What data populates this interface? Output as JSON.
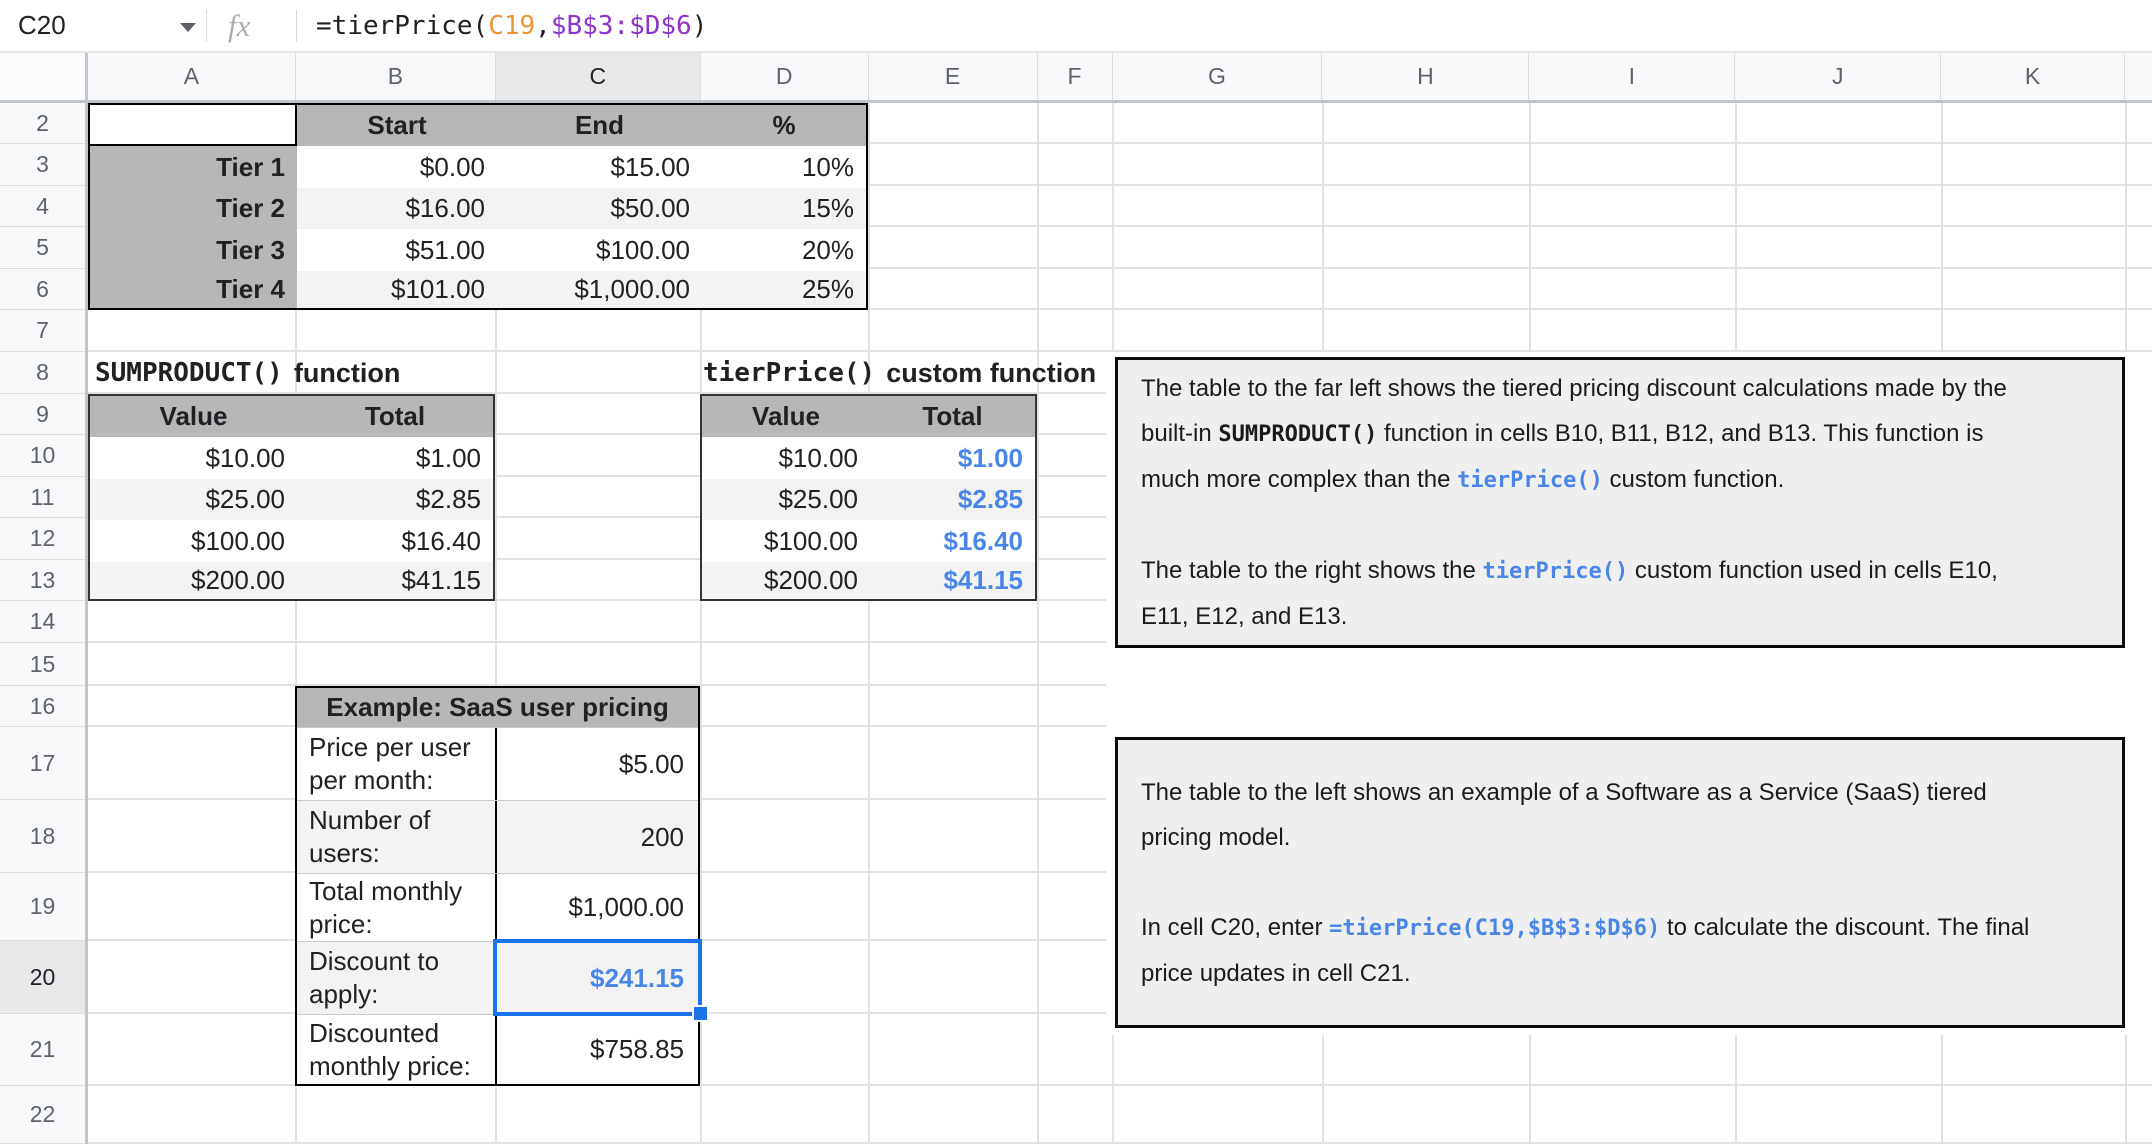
{
  "colors": {
    "accent_blue": "#4a86e8",
    "selection_blue": "#1a73e8",
    "token_orange": "#f09536",
    "token_purple": "#8d34c9",
    "table_header_gray": "#b7b7b7",
    "banding_gray": "#f3f3f3",
    "note_bg": "#efefef"
  },
  "formula_bar": {
    "name_box": "C20",
    "fx_label": "fx",
    "formula_segments": [
      {
        "text": "=tierPrice(",
        "style": "tok-default"
      },
      {
        "text": "C19",
        "style": "tok-orange"
      },
      {
        "text": ",",
        "style": "tok-default"
      },
      {
        "text": "$B$3:$D$6",
        "style": "tok-purple"
      },
      {
        "text": ")",
        "style": "tok-default"
      }
    ]
  },
  "grid": {
    "column_headers": [
      "A",
      "B",
      "C",
      "D",
      "E",
      "F",
      "G",
      "H",
      "I",
      "J",
      "K"
    ],
    "row_headers": [
      "2",
      "3",
      "4",
      "5",
      "6",
      "7",
      "8",
      "9",
      "10",
      "11",
      "12",
      "13",
      "14",
      "15",
      "16",
      "17",
      "18",
      "19",
      "20",
      "21",
      "22"
    ],
    "selected_cell": "C20",
    "selected_column": "C",
    "selected_row": "20"
  },
  "tier_table": {
    "headers": {
      "start": "Start",
      "end": "End",
      "pct": "%"
    },
    "rows": [
      {
        "label": "Tier 1",
        "start": "$0.00",
        "end": "$15.00",
        "pct": "10%"
      },
      {
        "label": "Tier 2",
        "start": "$16.00",
        "end": "$50.00",
        "pct": "15%"
      },
      {
        "label": "Tier 3",
        "start": "$51.00",
        "end": "$100.00",
        "pct": "20%"
      },
      {
        "label": "Tier 4",
        "start": "$101.00",
        "end": "$1,000.00",
        "pct": "25%"
      }
    ]
  },
  "sumproduct_section": {
    "title_mono": "SUMPRODUCT()",
    "title_rest": "function",
    "headers": {
      "value": "Value",
      "total": "Total"
    },
    "rows": [
      {
        "value": "$10.00",
        "total": "$1.00"
      },
      {
        "value": "$25.00",
        "total": "$2.85"
      },
      {
        "value": "$100.00",
        "total": "$16.40"
      },
      {
        "value": "$200.00",
        "total": "$41.15"
      }
    ]
  },
  "tierprice_section": {
    "title_mono": "tierPrice()",
    "title_rest": "custom function",
    "headers": {
      "value": "Value",
      "total": "Total"
    },
    "rows": [
      {
        "value": "$10.00",
        "total": "$1.00"
      },
      {
        "value": "$25.00",
        "total": "$2.85"
      },
      {
        "value": "$100.00",
        "total": "$16.40"
      },
      {
        "value": "$200.00",
        "total": "$41.15"
      }
    ]
  },
  "saas_table": {
    "title": "Example: SaaS user pricing",
    "rows": [
      {
        "label": "Price per user per month:",
        "value": "$5.00"
      },
      {
        "label": "Number of users:",
        "value": "200"
      },
      {
        "label": "Total monthly price:",
        "value": "$1,000.00"
      },
      {
        "label": "Discount to apply:",
        "value": "$241.15"
      },
      {
        "label": "Discounted monthly price:",
        "value": "$758.85"
      }
    ]
  },
  "note_box_1": {
    "paragraphs": [
      [
        {
          "text": "The table to the far left shows the tiered pricing discount calculations made by the\nbuilt-in "
        },
        {
          "text": "SUMPRODUCT()",
          "style": "mono"
        },
        {
          "text": " function in cells B10, B11, B12, and B13. This function is\nmuch more complex than the "
        },
        {
          "text": "tierPrice()",
          "style": "mono-blue"
        },
        {
          "text": " custom function."
        }
      ],
      [
        {
          "text": "The table to the right shows the "
        },
        {
          "text": "tierPrice()",
          "style": "mono-blue"
        },
        {
          "text": " custom function used in cells E10,\nE11, E12, and E13."
        }
      ]
    ]
  },
  "note_box_2": {
    "paragraphs": [
      [
        {
          "text": "The table to the left shows an example of a Software as a Service (SaaS) tiered\npricing model."
        }
      ],
      [
        {
          "text": "In cell C20, enter "
        },
        {
          "text": "=tierPrice(C19,$B$3:$D$6)",
          "style": "mono-blue"
        },
        {
          "text": " to calculate the discount. The final\nprice updates in cell C21."
        }
      ]
    ]
  }
}
